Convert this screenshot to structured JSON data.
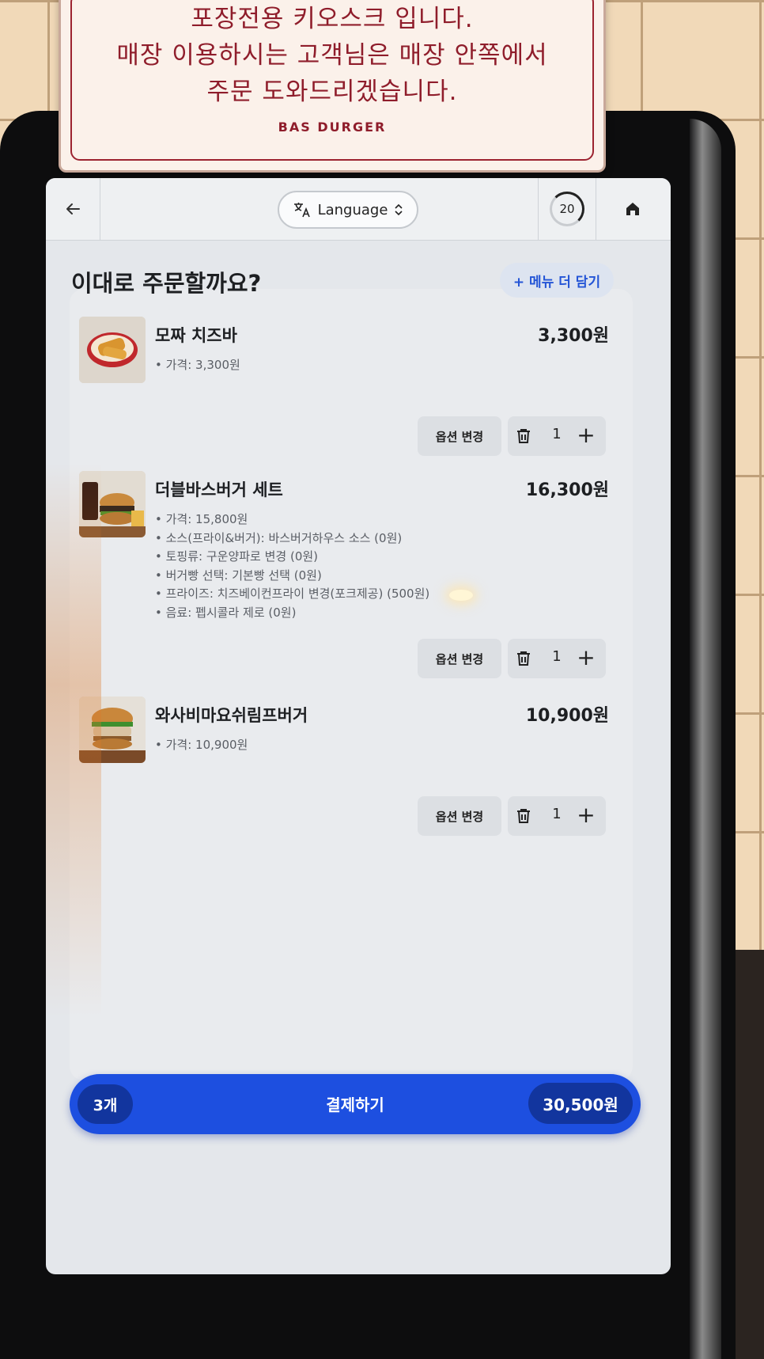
{
  "sign": {
    "lines": [
      "포장전용 키오스크 입니다.",
      "매장 이용하시는 고객님은 매장 안쪽에서",
      "주문 도와드리겠습니다."
    ],
    "brand": "BAS DURGER"
  },
  "topbar": {
    "back_icon": "arrow-left-icon",
    "language_label": "Language",
    "timer": "20",
    "home_icon": "home-icon"
  },
  "page": {
    "title": "이대로 주문할까요?",
    "add_more_label": "+ 메뉴 더 담기"
  },
  "cart": {
    "items": [
      {
        "name": "모짜 치즈바",
        "price": "3,300원",
        "options": [
          "가격: 3,300원"
        ],
        "option_button": "옵션 변경",
        "qty": "1"
      },
      {
        "name": "더블바스버거 세트",
        "price": "16,300원",
        "options": [
          "가격: 15,800원",
          "소스(프라이&버거): 바스버거하우스 소스 (0원)",
          "토핑류: 구운양파로 변경 (0원)",
          "버거빵 선택: 기본빵 선택 (0원)",
          "프라이즈: 치즈베이컨프라이 변경(포크제공) (500원)",
          "음료: 펩시콜라 제로 (0원)"
        ],
        "option_button": "옵션 변경",
        "qty": "1"
      },
      {
        "name": "와사비마요쉬림프버거",
        "price": "10,900원",
        "options": [
          "가격: 10,900원"
        ],
        "option_button": "옵션 변경",
        "qty": "1"
      }
    ]
  },
  "pay": {
    "count": "3개",
    "label": "결제하기",
    "total": "30,500원"
  }
}
